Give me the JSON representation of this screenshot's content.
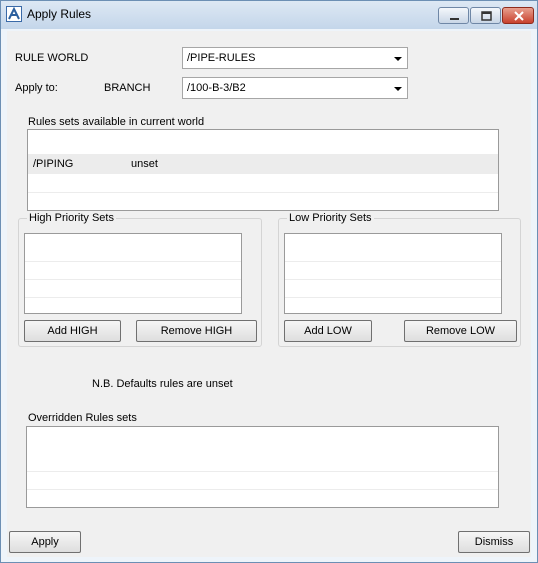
{
  "window": {
    "title": "Apply Rules"
  },
  "rule_world": {
    "label": "RULE WORLD",
    "value": "/PIPE-RULES"
  },
  "apply_to": {
    "label": "Apply to:",
    "type": "BRANCH",
    "value": "/100-B-3/B2"
  },
  "rulesets": {
    "label": "Rules sets available in current world",
    "rows": [
      {
        "name": "/PIPING",
        "status": "unset"
      }
    ]
  },
  "high_priority": {
    "label": "High Priority Sets",
    "add": "Add HIGH",
    "remove": "Remove HIGH"
  },
  "low_priority": {
    "label": "Low Priority Sets",
    "add": "Add LOW",
    "remove": "Remove LOW"
  },
  "note": "N.B. Defaults rules are unset",
  "overridden": {
    "label": "Overridden Rules sets"
  },
  "footer": {
    "apply": "Apply",
    "dismiss": "Dismiss"
  },
  "icons": {
    "app": "app-a-icon",
    "dropdown": "chevron-down-icon"
  }
}
